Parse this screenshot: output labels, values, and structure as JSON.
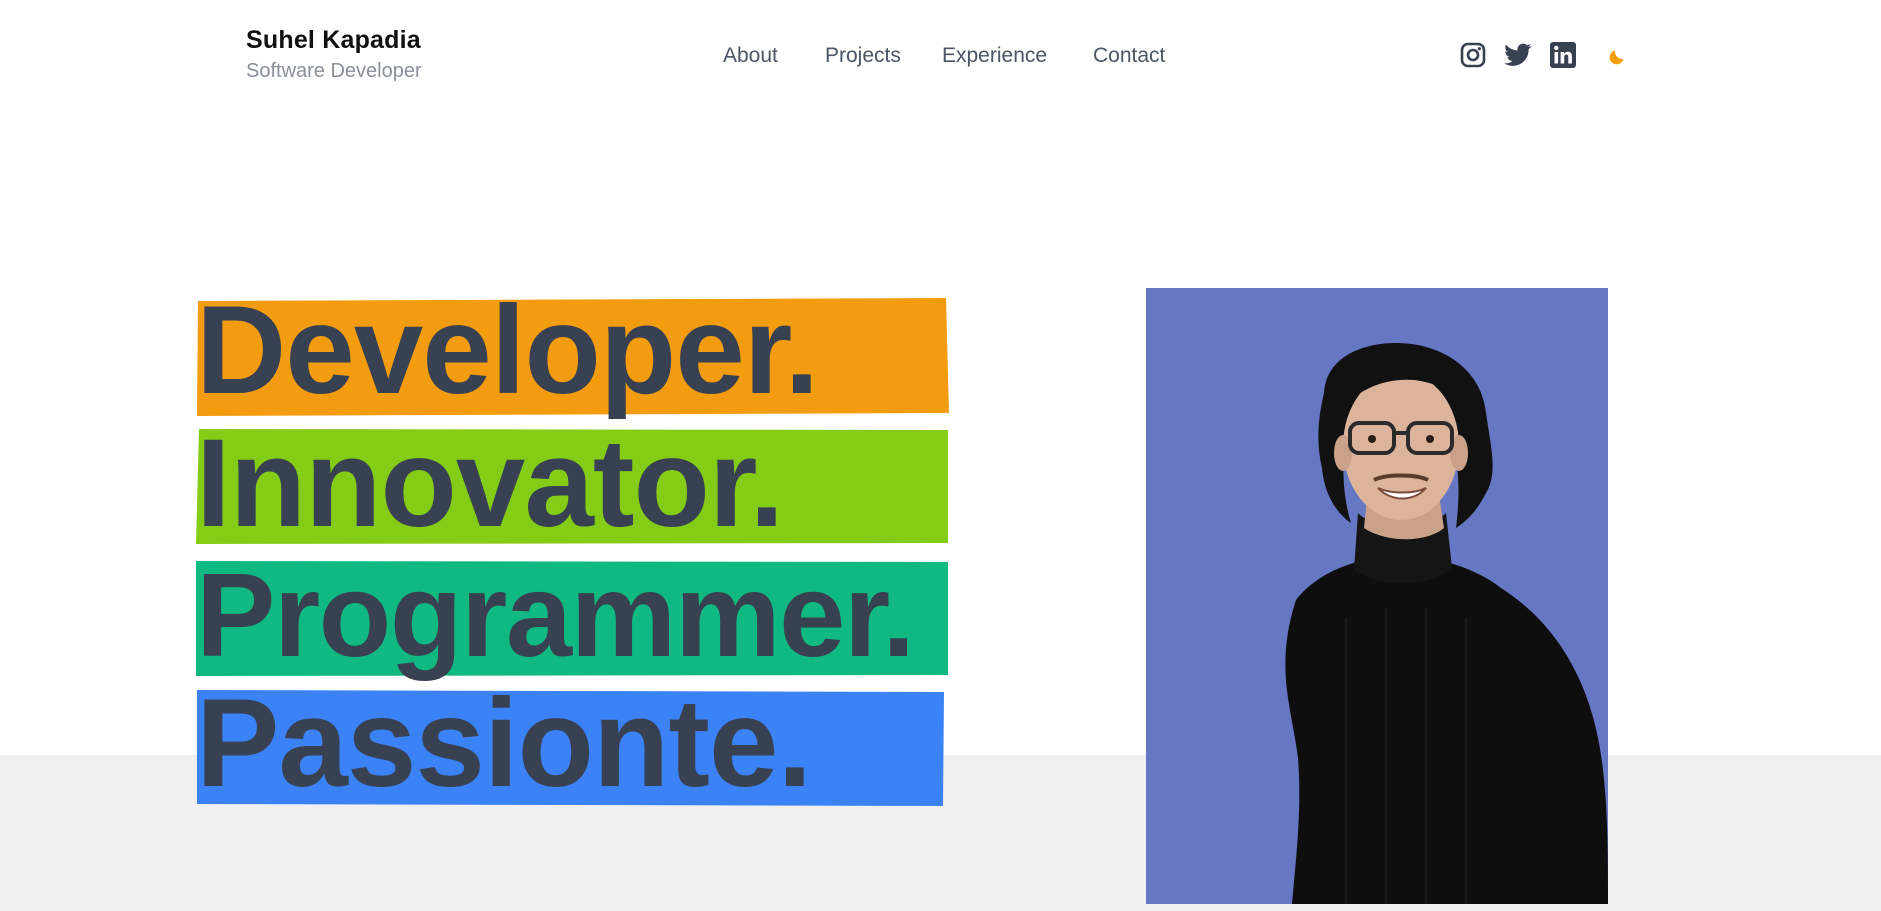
{
  "header": {
    "name": "Suhel Kapadia",
    "role": "Software Developer"
  },
  "nav": {
    "items": [
      {
        "label": "About"
      },
      {
        "label": "Projects"
      },
      {
        "label": "Experience"
      },
      {
        "label": "Contact"
      }
    ]
  },
  "social": {
    "icons": [
      "instagram-icon",
      "twitter-icon",
      "linkedin-icon"
    ],
    "theme_icon": "moon-icon"
  },
  "hero": {
    "words": [
      {
        "text": "Developer.",
        "color": "#f39c0f"
      },
      {
        "text": "Innovator.",
        "color": "#84cc16"
      },
      {
        "text": "Programmer.",
        "color": "#10b981"
      },
      {
        "text": "Passionte.",
        "color": "#3b82f6"
      }
    ],
    "text_color": "#374151"
  },
  "portrait": {
    "background": "#6677c4"
  },
  "colors": {
    "accent": "#f59e0b",
    "nav_text": "#4b5563",
    "band_grey": "#f0f0f0"
  }
}
